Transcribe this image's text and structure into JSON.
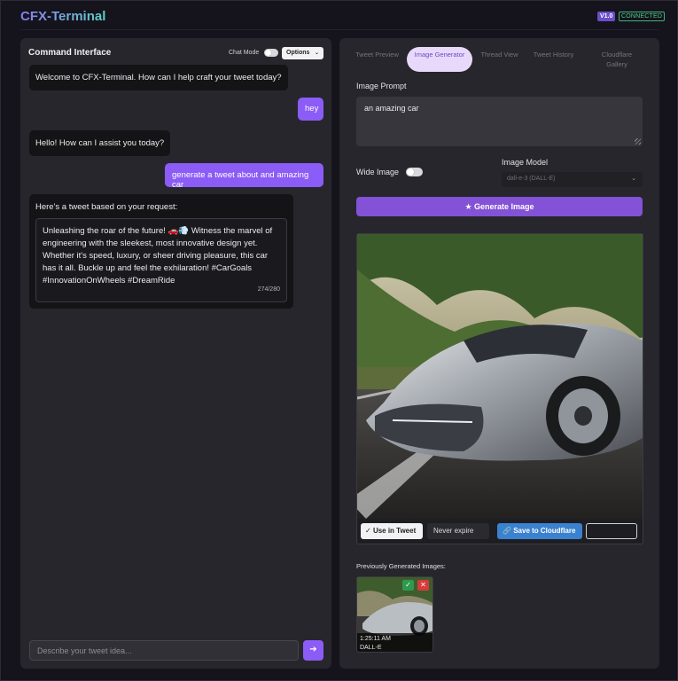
{
  "app": {
    "title": "CFX-Terminal",
    "version": "V1.0",
    "status": "CONNECTED"
  },
  "left": {
    "title": "Command Interface",
    "chat_mode_label": "Chat Mode",
    "options_label": "Options",
    "messages": [
      {
        "role": "assistant",
        "text": "Welcome to CFX-Terminal. How can I help craft your tweet today?"
      },
      {
        "role": "user",
        "text": "hey"
      },
      {
        "role": "assistant",
        "text": "Hello! How can I assist you today?"
      },
      {
        "role": "user",
        "text": "generate a tweet about and amazing car"
      },
      {
        "role": "assistant",
        "text": "Here's a tweet based on your request:"
      }
    ],
    "tweet": {
      "text": "Unleashing the roar of the future! 🚗💨 Witness the marvel of engineering with the sleekest, most innovative design yet. Whether it's speed, luxury, or sheer driving pleasure, this car has it all. Buckle up and feel the exhilaration! #CarGoals #InnovationOnWheels #DreamRide",
      "char_count": "274/280"
    },
    "input_placeholder": "Describe your tweet idea...",
    "send_icon": "arrow-right-icon"
  },
  "right": {
    "tabs": [
      {
        "label": "Tweet Preview",
        "active": false
      },
      {
        "label": "Image Generator",
        "active": true
      },
      {
        "label": "Thread View",
        "active": false
      },
      {
        "label": "Tweet History",
        "active": false
      },
      {
        "label": "Cloudflare Gallery",
        "active": false
      }
    ],
    "prompt_label": "Image Prompt",
    "prompt_value": "an amazing car",
    "wide_image_label": "Wide Image",
    "wide_image_on": false,
    "model_label": "Image Model",
    "model_value": "dall-e-3 (DALL-E)",
    "generate_label": "Generate Image",
    "use_in_tweet_label": "Use in Tweet",
    "expiry_value": "Never expire",
    "save_cloudflare_label": "Save to Cloudflare",
    "previous_label": "Previously Generated Images:",
    "thumbnail": {
      "time": "1:25:11 AM",
      "model": "DALL-E"
    }
  },
  "colors": {
    "accent": "#8b5cf6",
    "cloudflare": "#3a82cf",
    "connected": "#4fd08d"
  }
}
